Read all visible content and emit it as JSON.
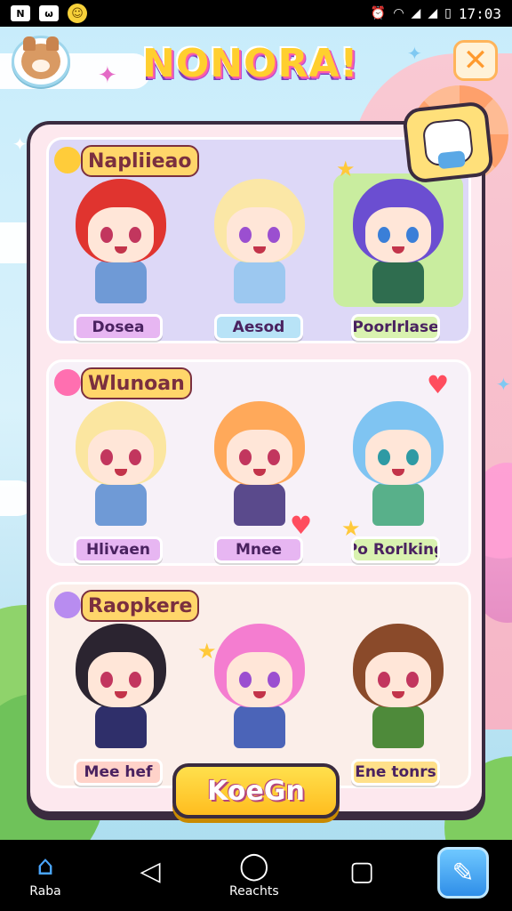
{
  "status_bar": {
    "icons_left": [
      "N",
      "ω"
    ],
    "sun_icon": "☺",
    "time": "17:03",
    "icons_right": [
      "alarm-icon",
      "wifi-icon",
      "signal-icon",
      "signal-icon",
      "battery-icon"
    ]
  },
  "header": {
    "title": "NONORA!",
    "avatar_icon": "bear-avatar-icon",
    "close_label": "✕"
  },
  "rows": [
    {
      "title": "Napliieao",
      "characters": [
        {
          "name": "Dosea",
          "hair": "#e0342f",
          "outfit": "#6f9ad6",
          "tag": "#e7b6f2",
          "eye": "#c2365e"
        },
        {
          "name": "Aesod",
          "hair": "#fbe7a6",
          "outfit": "#9cc8f0",
          "tag": "#b8e3f7",
          "eye": "#9b4fd0"
        },
        {
          "name": "Poorlrlase",
          "hair": "#6b4ed1",
          "outfit": "#2f6d4f",
          "tag": "#d9f2b0",
          "eye": "#3a7fd8"
        }
      ]
    },
    {
      "title": "Wlunoan",
      "characters": [
        {
          "name": "Hlivaen",
          "hair": "#fbe6a0",
          "outfit": "#6f9ad6",
          "tag": "#e7b6f2",
          "eye": "#c2365e"
        },
        {
          "name": "Mnee",
          "hair": "#ffa95a",
          "outfit": "#5a4a8c",
          "tag": "#e7b6f2",
          "eye": "#c2365e"
        },
        {
          "name": "Po Rorlking",
          "hair": "#7fc4f2",
          "outfit": "#58b08a",
          "tag": "#d9f2b0",
          "eye": "#2e9aa4"
        }
      ]
    },
    {
      "title": "Raopkere",
      "characters": [
        {
          "name": "Mee hef",
          "hair": "#2b2430",
          "outfit": "#2f2f6a",
          "tag": "#ffd2c9",
          "eye": "#c2365e"
        },
        {
          "name": "",
          "hair": "#f47dd0",
          "outfit": "#4b64b8",
          "tag": "#b8e3f7",
          "eye": "#9b4fd0"
        },
        {
          "name": "Ene tonrs",
          "hair": "#8a4a2a",
          "outfit": "#4e8a3a",
          "tag": "#ffe08a",
          "eye": "#c2365e"
        }
      ]
    }
  ],
  "action_button": {
    "label": "KoeGn"
  },
  "nav": {
    "home_label": "Raba",
    "home_icon": "home-icon",
    "back_icon": "back-triangle-icon",
    "center_label": "Reachts",
    "center_icon": "circle-home-icon",
    "recents_icon": "square-recents-icon",
    "tool_icon": "magic-wand-icon"
  },
  "colors": {
    "panel_border": "#3a2b3f",
    "accent_yellow": "#ffcf2f",
    "accent_pink": "#ff5fa2"
  }
}
